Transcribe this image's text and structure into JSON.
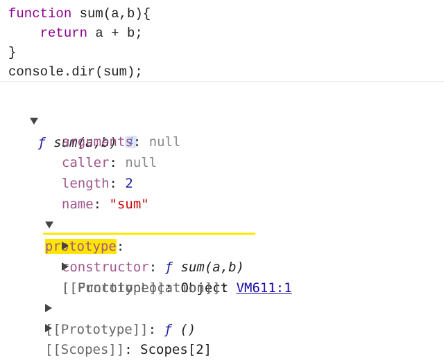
{
  "code_lines": {
    "l1_kw": "function",
    "l1_rest": " sum(a,b){",
    "l2_indent": "    ",
    "l2_kw": "return",
    "l2_rest": " a + b;",
    "l3": "}",
    "l4": "console.dir(sum);"
  },
  "tree": {
    "root": {
      "glyph": "ƒ",
      "signature": "sum(a,b)",
      "info_icon": "info-icon",
      "info_glyph": "i"
    },
    "arguments": {
      "key": "arguments",
      "value": "null"
    },
    "caller": {
      "key": "caller",
      "value": "null"
    },
    "length": {
      "key": "length",
      "value": "2"
    },
    "name": {
      "key": "name",
      "value": "\"sum\""
    },
    "prototype": {
      "key": "prototype",
      "constructor": {
        "key": "constructor",
        "glyph": "ƒ",
        "signature": "sum(a,b)"
      },
      "proto": {
        "key": "[[Prototype]]",
        "value": "Object"
      }
    },
    "function_location": {
      "key": "[[FunctionLocation]]",
      "value": "VM611:1"
    },
    "proto_fn": {
      "key": "[[Prototype]]",
      "glyph": "ƒ",
      "value": "()"
    },
    "scopes": {
      "key": "[[Scopes]]",
      "value": "Scopes[2]"
    }
  },
  "colors": {
    "keyword": "#8b008b",
    "key": "#a0558d",
    "highlight": "#ffe600",
    "link": "#1a0dab"
  }
}
